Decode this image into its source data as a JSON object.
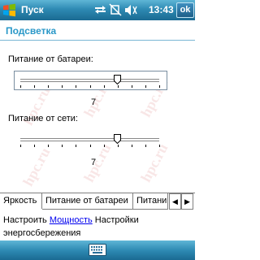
{
  "titlebar": {
    "app_title": "Пуск",
    "time": "13:43",
    "ok_label": "ok"
  },
  "header": {
    "title": "Подсветка"
  },
  "battery": {
    "label": "Питание от батареи:",
    "value": "7",
    "level": 7,
    "max": 10
  },
  "ac": {
    "label": "Питание от сети:",
    "value": "7",
    "level": 7,
    "max": 10
  },
  "tabs": [
    {
      "label": "Яркость",
      "active": true
    },
    {
      "label": "Питание от батареи",
      "active": false
    },
    {
      "label": "Питани",
      "active": false
    }
  ],
  "footer": {
    "prefix": "Настроить ",
    "link": "Мощность",
    "suffix": " Настройки энергосбережения"
  },
  "watermark": "hpc.ru",
  "colors": {
    "accent": "#2a98c8",
    "bar": "#2e8ab3",
    "link": "#0000ee"
  },
  "icons": [
    "windows-start-icon",
    "connectivity-icon",
    "no-signal-icon",
    "volume-icon",
    "keyboard-icon"
  ]
}
